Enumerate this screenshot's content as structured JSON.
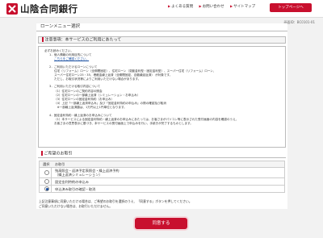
{
  "header": {
    "logo_text": "山陰合同銀行",
    "links": [
      "よくある質問",
      "お問い合わせ",
      "サイトマップ"
    ],
    "top_button": "トップページへ"
  },
  "screen_id": "画面ID：BC0101-01",
  "page_title": "ローンメニュー選択",
  "notice_section": {
    "heading": "注意事項：本サービスのご利用にあたって",
    "lines": [
      "必ずお読みください。",
      "1．個人情報の利用目的について",
      "こちらをご確認ください。",
      "",
      "2．ご利用いただけるローンについて",
      "住宅（リフォーム）ローン（全期間固定）、住宅ローン（変動金利型・固定金利型）、スーパー住宅（リフォーム）ローン、",
      "スーパー住宅ローン25・35、埋蔵金繰上返済（全期間固定、自動繰延返済） が対象です。",
      "ただし、お取引状況等によりご利用いただけない場合があります。",
      "",
      "3．ご利用いただける取引内容について",
      "（1）住宅ローンのご契約内容の照会",
      "（2）住宅ローンの一部繰上返済（シミュレーション・お申込み）",
      "（3）住宅ローンの固定金利特約（お申込み）",
      "（4）上記「一部繰上返済申込み」及び「固定金利特約の申込み」の際の確認及び取消",
      "　※一部繰上返済額は、1万円以上1円単位となります。",
      "",
      "4．固定金利特約・繰上返済のお申込みについて",
      "（1）本サービスによる固定金利特約・繰上返済のお申込みにあたっては、お客さまがパソコン等に表示された受付画面の内容を確認のうえ、",
      "お客さまの意思表示に基づき、本サービスの受付画面上で申込みを行い、手続きが完了するものとします。"
    ]
  },
  "selection_section": {
    "heading": "ご希望のお取引",
    "col_select": "選択",
    "col_transaction": "お取引",
    "options": [
      {
        "label": "残高照会・返済予定表照会・繰上返済予約",
        "sub": "（繰上返済シミュレーション）",
        "selected": false
      },
      {
        "label": "固定金利特約の申込み",
        "sub": "",
        "selected": false
      },
      {
        "label": "申込済み取引の確認・取消",
        "sub": "",
        "selected": true
      }
    ]
  },
  "bottom_notice": [
    "上記注意事項に同意いただける場合は、ご希望のお取引を選択のうえ、「同意する」ボタンを押してください。",
    "ご同意いただけない場合は、お取引いただけません。"
  ],
  "agree_button": "同意する"
}
